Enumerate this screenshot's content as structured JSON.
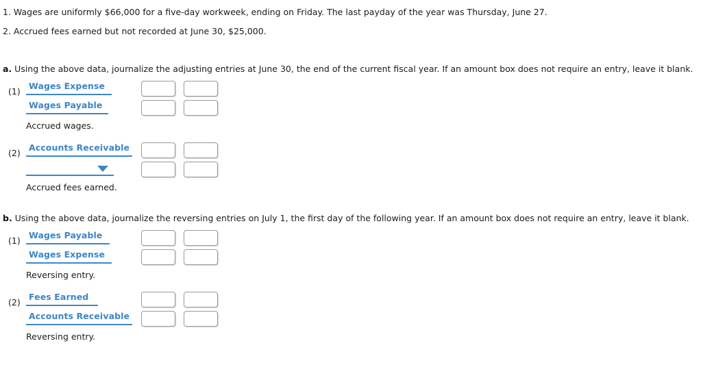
{
  "given": {
    "items": [
      {
        "num": "1.",
        "text": "Wages are uniformly $66,000 for a five-day workweek, ending on Friday. The last payday of the year was Thursday, June 27."
      },
      {
        "num": "2.",
        "text": "Accrued fees earned but not recorded at June 30, $25,000."
      }
    ]
  },
  "colors": {
    "account_blue": "#3d86c6",
    "text_black": "#1b1b1b",
    "box_border": "#9a9a9a"
  },
  "parts": [
    {
      "letter": "a.",
      "instruction": "Using the above data, journalize the adjusting entries at June 30, the end of the current fiscal year. If an amount box does not require an entry, leave it blank.",
      "entries": [
        {
          "marker": "(1)",
          "rows": [
            {
              "account": "Wages Expense",
              "caret": false,
              "debit": "",
              "credit": ""
            },
            {
              "account": "Wages Payable",
              "caret": false,
              "debit": "",
              "credit": ""
            }
          ],
          "memo": "Accrued wages."
        },
        {
          "marker": "(2)",
          "rows": [
            {
              "account": "Accounts Receivable",
              "caret": false,
              "debit": "",
              "credit": ""
            },
            {
              "account": "",
              "caret": true,
              "debit": "",
              "credit": ""
            }
          ],
          "memo": "Accrued fees earned."
        }
      ]
    },
    {
      "letter": "b.",
      "instruction": "Using the above data, journalize the reversing entries on July 1, the first day of the following year. If an amount box does not require an entry, leave it blank.",
      "entries": [
        {
          "marker": "(1)",
          "rows": [
            {
              "account": "Wages Payable",
              "caret": false,
              "debit": "",
              "credit": ""
            },
            {
              "account": "Wages Expense",
              "caret": false,
              "debit": "",
              "credit": ""
            }
          ],
          "memo": "Reversing entry."
        },
        {
          "marker": "(2)",
          "rows": [
            {
              "account": "Fees Earned",
              "caret": false,
              "debit": "",
              "credit": ""
            },
            {
              "account": "Accounts Receivable",
              "caret": false,
              "debit": "",
              "credit": ""
            }
          ],
          "memo": "Reversing entry."
        }
      ]
    }
  ]
}
